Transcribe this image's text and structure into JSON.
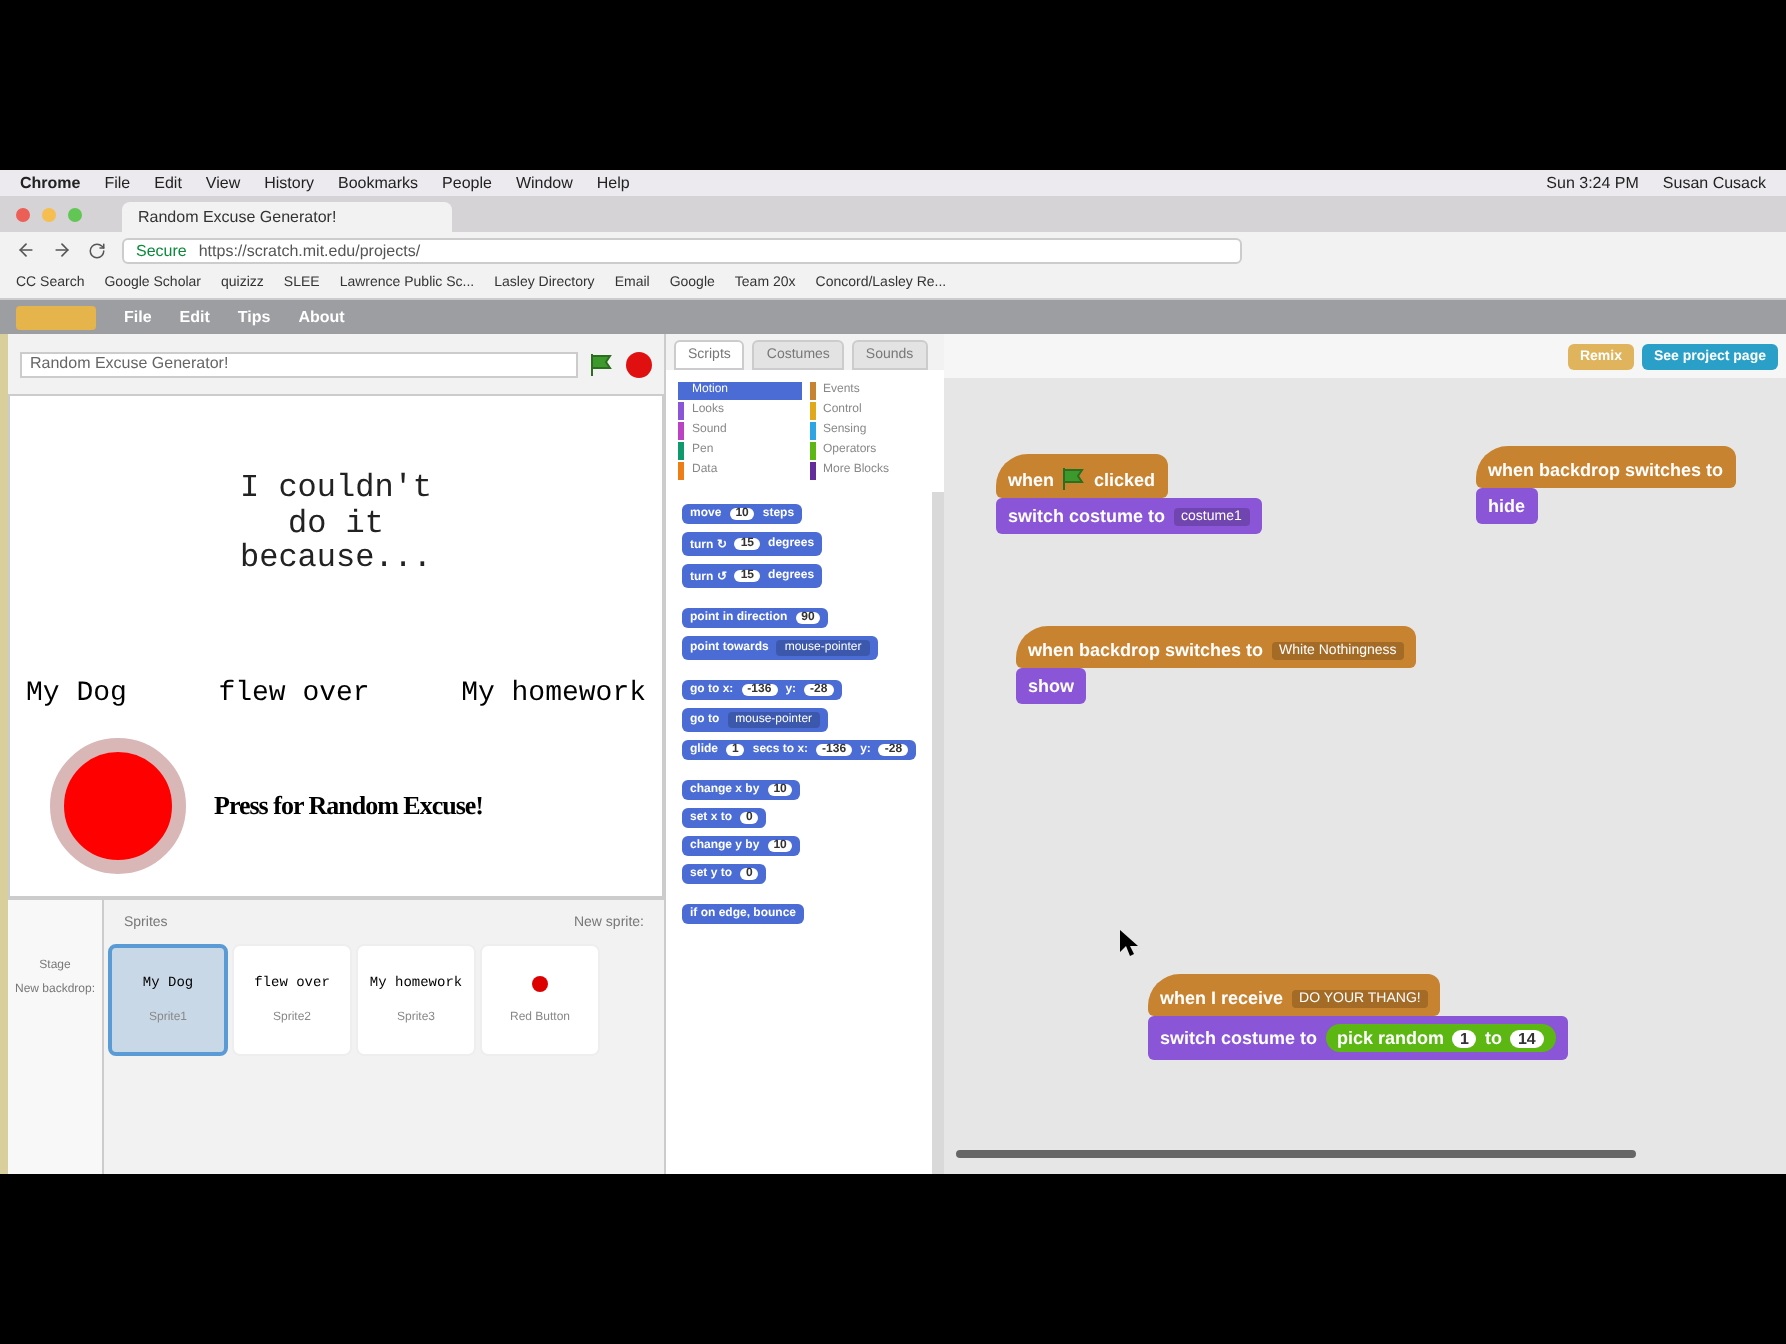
{
  "menubar": {
    "items": [
      "Chrome",
      "File",
      "Edit",
      "View",
      "History",
      "Bookmarks",
      "People",
      "Window",
      "Help"
    ],
    "clock": "Sun 3:24 PM",
    "user": "Susan Cusack"
  },
  "browser_tab": {
    "title": "Random Excuse Generator!"
  },
  "address_bar": {
    "secure_label": "Secure",
    "url": "https://scratch.mit.edu/projects/"
  },
  "bookmarks": [
    "CC Search",
    "Google Scholar",
    "quizizz",
    "SLEE",
    "Lawrence Public Sc...",
    "Lasley Directory",
    "Email",
    "Google",
    "Team 20x",
    "Concord/Lasley Re..."
  ],
  "scratch_menu": {
    "items": [
      "File",
      "Edit",
      "Tips",
      "About"
    ]
  },
  "project": {
    "title": "Random Excuse Generator!"
  },
  "editor_tabs": [
    {
      "label": "Scripts",
      "selected": true
    },
    {
      "label": "Costumes",
      "selected": false
    },
    {
      "label": "Sounds",
      "selected": false
    }
  ],
  "header_buttons": [
    {
      "label": "Remix",
      "kind": "remix"
    },
    {
      "label": "See project page",
      "kind": "page"
    }
  ],
  "stage": {
    "heading": "I couldn't do it because...",
    "words": [
      "My Dog",
      "flew over",
      "My homework"
    ],
    "button_label": "Press for Random Excuse!"
  },
  "sprites": {
    "title": "Sprites",
    "new_sprite": "New sprite:",
    "stage_label": "Stage",
    "new_backdrop": "New backdrop:",
    "items": [
      {
        "preview": "My Dog",
        "name": "Sprite1",
        "selected": true
      },
      {
        "preview": "flew over",
        "name": "Sprite2",
        "selected": false
      },
      {
        "preview": "My homework",
        "name": "Sprite3",
        "selected": false
      },
      {
        "name": "Red Button",
        "selected": false
      }
    ]
  },
  "categories": [
    {
      "label": "Motion",
      "color": "#4a6cd4",
      "selected": true
    },
    {
      "label": "Events",
      "color": "#c88330",
      "selected": false
    },
    {
      "label": "Looks",
      "color": "#8a55d7",
      "selected": false
    },
    {
      "label": "Control",
      "color": "#e1a91a",
      "selected": false
    },
    {
      "label": "Sound",
      "color": "#bb42c3",
      "selected": false
    },
    {
      "label": "Sensing",
      "color": "#2ca5e2",
      "selected": false
    },
    {
      "label": "Pen",
      "color": "#0e9a6c",
      "selected": false
    },
    {
      "label": "Operators",
      "color": "#5cb712",
      "selected": false
    },
    {
      "label": "Data",
      "color": "#ee7d16",
      "selected": false
    },
    {
      "label": "More Blocks",
      "color": "#632d99",
      "selected": false
    }
  ],
  "palette_groups": [
    [
      {
        "parts": [
          {
            "kind": "text",
            "text": "move"
          },
          {
            "kind": "input",
            "text": "10"
          },
          {
            "kind": "text",
            "text": "steps"
          }
        ]
      },
      {
        "parts": [
          {
            "kind": "text",
            "text": "turn ↻"
          },
          {
            "kind": "input",
            "text": "15"
          },
          {
            "kind": "text",
            "text": "degrees"
          }
        ]
      },
      {
        "parts": [
          {
            "kind": "text",
            "text": "turn ↺"
          },
          {
            "kind": "input",
            "text": "15"
          },
          {
            "kind": "text",
            "text": "degrees"
          }
        ]
      }
    ],
    [
      {
        "parts": [
          {
            "kind": "text",
            "text": "point in direction"
          },
          {
            "kind": "input",
            "text": "90"
          }
        ]
      },
      {
        "parts": [
          {
            "kind": "text",
            "text": "point towards"
          },
          {
            "kind": "dropdown",
            "text": "mouse-pointer"
          }
        ]
      }
    ],
    [
      {
        "parts": [
          {
            "kind": "text",
            "text": "go to x:"
          },
          {
            "kind": "input",
            "text": "-136"
          },
          {
            "kind": "text",
            "text": "y:"
          },
          {
            "kind": "input",
            "text": "-28"
          }
        ]
      },
      {
        "parts": [
          {
            "kind": "text",
            "text": "go to"
          },
          {
            "kind": "dropdown",
            "text": "mouse-pointer"
          }
        ]
      },
      {
        "parts": [
          {
            "kind": "text",
            "text": "glide"
          },
          {
            "kind": "input",
            "text": "1"
          },
          {
            "kind": "text",
            "text": "secs to x:"
          },
          {
            "kind": "input",
            "text": "-136"
          },
          {
            "kind": "text",
            "text": "y:"
          },
          {
            "kind": "input",
            "text": "-28"
          }
        ]
      }
    ],
    [
      {
        "parts": [
          {
            "kind": "text",
            "text": "change x by"
          },
          {
            "kind": "input",
            "text": "10"
          }
        ]
      },
      {
        "parts": [
          {
            "kind": "text",
            "text": "set x to"
          },
          {
            "kind": "input",
            "text": "0"
          }
        ]
      },
      {
        "parts": [
          {
            "kind": "text",
            "text": "change y by"
          },
          {
            "kind": "input",
            "text": "10"
          }
        ]
      },
      {
        "parts": [
          {
            "kind": "text",
            "text": "set y to"
          },
          {
            "kind": "input",
            "text": "0"
          }
        ]
      }
    ],
    [
      {
        "parts": [
          {
            "kind": "text",
            "text": "if on edge, bounce"
          }
        ]
      }
    ]
  ],
  "scripts": [
    {
      "blocks": [
        {
          "kind": "event_hat",
          "parts": [
            {
              "kind": "text",
              "text": "when"
            },
            {
              "kind": "flag"
            },
            {
              "kind": "text",
              "text": "clicked"
            }
          ]
        },
        {
          "kind": "looks",
          "parts": [
            {
              "kind": "text",
              "text": "switch costume to"
            },
            {
              "kind": "dropdown",
              "text": "costume1"
            }
          ]
        }
      ]
    },
    {
      "blocks": [
        {
          "kind": "event_hat",
          "parts": [
            {
              "kind": "text",
              "text": "when backdrop switches to"
            }
          ]
        },
        {
          "kind": "looks",
          "parts": [
            {
              "kind": "text",
              "text": "hide"
            }
          ]
        }
      ]
    },
    {
      "blocks": [
        {
          "kind": "event_hat",
          "parts": [
            {
              "kind": "text",
              "text": "when backdrop switches to"
            },
            {
              "kind": "dropdown",
              "text": "White Nothingness"
            }
          ]
        },
        {
          "kind": "looks",
          "parts": [
            {
              "kind": "text",
              "text": "show"
            }
          ]
        }
      ]
    },
    {
      "blocks": [
        {
          "kind": "event_hat",
          "parts": [
            {
              "kind": "text",
              "text": "when I receive"
            },
            {
              "kind": "dropdown",
              "text": "DO YOUR THANG!"
            }
          ]
        },
        {
          "kind": "looks",
          "parts": [
            {
              "kind": "text",
              "text": "switch costume to"
            },
            {
              "kind": "operator",
              "parts": [
                {
                  "kind": "text",
                  "text": "pick random"
                },
                {
                  "kind": "input",
                  "text": "1"
                },
                {
                  "kind": "text",
                  "text": "to"
                },
                {
                  "kind": "input",
                  "text": "14"
                }
              ]
            }
          ]
        }
      ]
    }
  ]
}
